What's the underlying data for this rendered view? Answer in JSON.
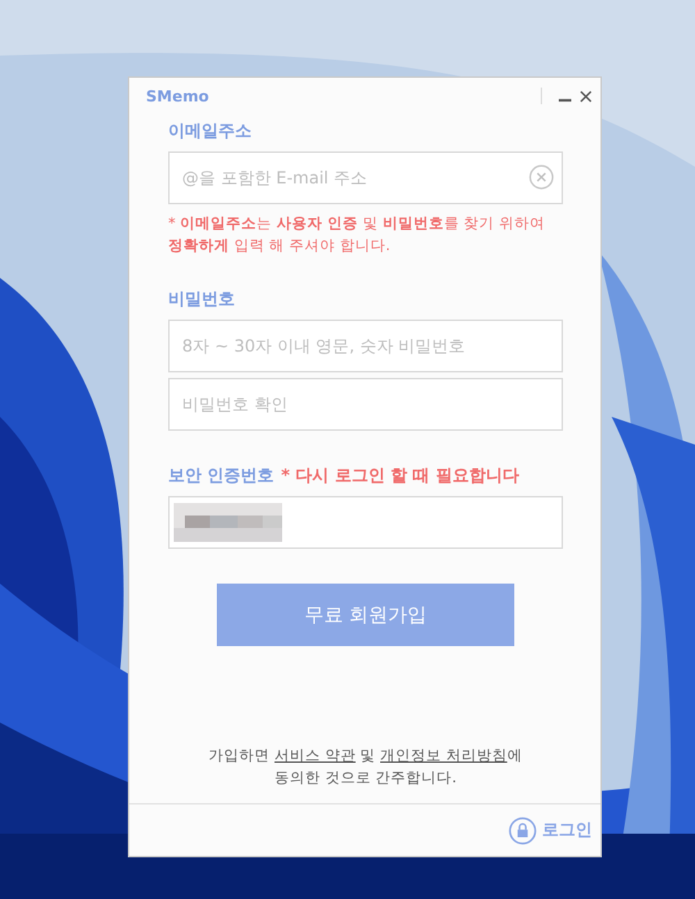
{
  "window": {
    "title": "SMemo"
  },
  "email": {
    "label": "이메일주소",
    "placeholder": "@을 포함한 E-mail 주소",
    "note": "* **이메일주소**는 **사용자 인증** 및 **비밀번호**를 찾기 위하여 **정확하게** 입력 해 주셔야 합니다."
  },
  "password": {
    "label": "비밀번호",
    "placeholder": "8자 ~ 30자 이내 영문, 숫자 비밀번호",
    "confirm_placeholder": "비밀번호 확인"
  },
  "security_code": {
    "label": "보안 인증번호",
    "note": "* 다시 로그인 할 때 필요합니다"
  },
  "signup_button": "무료 회원가입",
  "terms": [
    {
      "kind": "text",
      "text": "가입하면 "
    },
    {
      "kind": "link",
      "text": "서비스 약관"
    },
    {
      "kind": "text",
      "text": " 및 "
    },
    {
      "kind": "link",
      "text": "개인정보 처리방침"
    },
    {
      "kind": "text",
      "text": "에 동의한 것으로 간주합니다."
    }
  ],
  "login_link": "로그인"
}
